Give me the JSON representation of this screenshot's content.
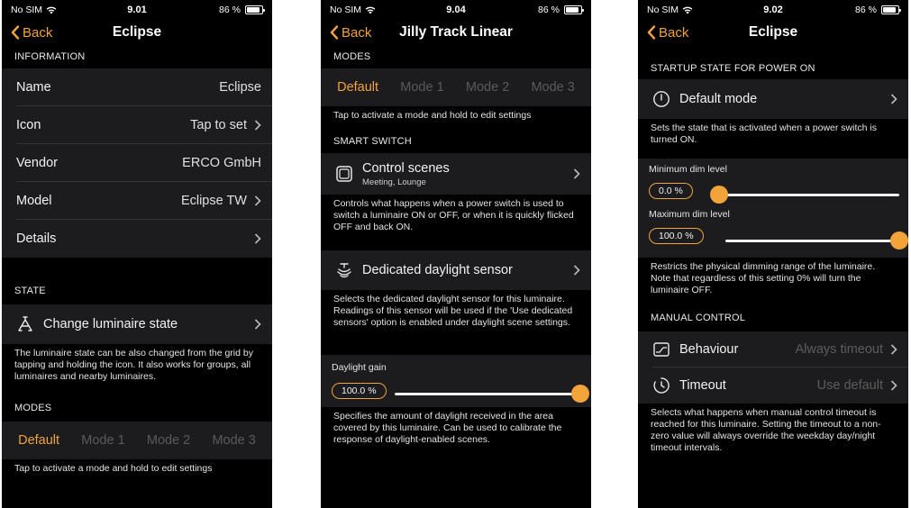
{
  "colors": {
    "accent": "#f2a33a",
    "background": "#000000",
    "cell": "#1c1c1e"
  },
  "screens": [
    {
      "status": {
        "carrier": "No SIM",
        "time": "9.01",
        "battery": "86 %"
      },
      "nav": {
        "back": "Back",
        "title": "Eclipse"
      },
      "info_header": "INFORMATION",
      "info_rows": [
        {
          "label": "Name",
          "value": "Eclipse"
        },
        {
          "label": "Icon",
          "value": "Tap to set"
        },
        {
          "label": "Vendor",
          "value": "ERCO GmbH"
        },
        {
          "label": "Model",
          "value": "Eclipse TW"
        },
        {
          "label": "Details",
          "value": ""
        }
      ],
      "state_header": "STATE",
      "state_row": "Change luminaire state",
      "state_note": "The luminaire state can be also changed from the grid by tapping and holding the icon. It also works for groups, all luminaires and nearby luminaires.",
      "modes_header": "MODES",
      "modes": [
        "Default",
        "Mode 1",
        "Mode 2",
        "Mode 3"
      ],
      "modes_note": "Tap to activate a mode and hold to edit settings"
    },
    {
      "status": {
        "carrier": "No SIM",
        "time": "9.04",
        "battery": "86 %"
      },
      "nav": {
        "back": "Back",
        "title": "Jilly Track Linear"
      },
      "modes_header": "MODES",
      "modes": [
        "Default",
        "Mode 1",
        "Mode 2",
        "Mode 3"
      ],
      "modes_note": "Tap to activate a mode and hold to edit settings",
      "smart_header": "SMART SWITCH",
      "control_scenes": {
        "title": "Control scenes",
        "subtitle": "Meeting, Lounge"
      },
      "control_note": "Controls what happens when a power switch is used to switch a luminaire ON or OFF, or when it is quickly flicked OFF and back ON.",
      "daylight_sensor": "Dedicated daylight sensor",
      "daylight_note": "Selects the dedicated daylight sensor for this luminaire. Readings of this sensor will be used if the 'Use dedicated sensors' option is enabled under daylight scene settings.",
      "gain": {
        "label": "Daylight gain",
        "value_text": "100.0 %",
        "level": 1.0
      },
      "gain_note": "Specifies the amount of daylight received in the area covered by this luminaire. Can be used to calibrate the response of daylight-enabled scenes."
    },
    {
      "status": {
        "carrier": "No SIM",
        "time": "9.02",
        "battery": "86 %"
      },
      "nav": {
        "back": "Back",
        "title": "Eclipse"
      },
      "startup_header": "STARTUP STATE FOR POWER ON",
      "startup_row": "Default mode",
      "startup_note": "Sets the state that is activated when a power switch is turned ON.",
      "min_dim": {
        "label": "Minimum dim level",
        "value_text": "0.0 %",
        "level": 0.0
      },
      "max_dim": {
        "label": "Maximum dim level",
        "value_text": "100.0 %",
        "level": 1.0
      },
      "dim_note": "Restricts the physical dimming range of the luminaire. Note that regardless of this setting 0% will turn the luminaire OFF.",
      "manual_header": "MANUAL CONTROL",
      "behaviour": {
        "label": "Behaviour",
        "value": "Always timeout"
      },
      "timeout": {
        "label": "Timeout",
        "value": "Use default"
      },
      "manual_note": "Selects what happens when manual control timeout is reached for this luminaire. Setting the timeout to a non-zero value will always override the weekday day/night timeout intervals."
    }
  ]
}
